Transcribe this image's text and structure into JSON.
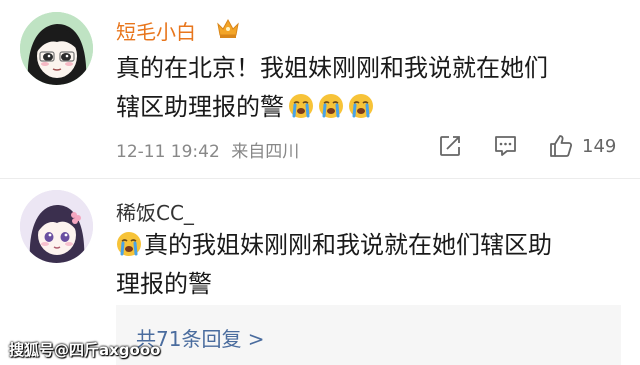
{
  "comments": [
    {
      "username": "短毛小白",
      "username_color": "#e8761d",
      "badge_icon": "crown-icon",
      "lines": [
        "真的在北京！我姐妹刚刚和我说就在她们",
        "辖区助理报的警"
      ],
      "emoji_icon": "crying-face-icon",
      "timestamp": "12-11 19:42",
      "location": "来自四川",
      "like_count": "149"
    },
    {
      "username": "稀饭CC_",
      "username_color": "#333333",
      "lines": [
        "真的我姐妹刚刚和我说就在她们辖区助",
        "理报的警"
      ],
      "emoji_icon": "crying-face-icon"
    }
  ],
  "replies": {
    "label": "共71条回复 >"
  },
  "watermark": {
    "text": "搜狐号@四斤axgooo"
  },
  "colors": {
    "link": "#4a6c9e",
    "meta": "#888888",
    "emoji_yellow": "#f7c338",
    "tear_blue": "#4aa3e6"
  }
}
